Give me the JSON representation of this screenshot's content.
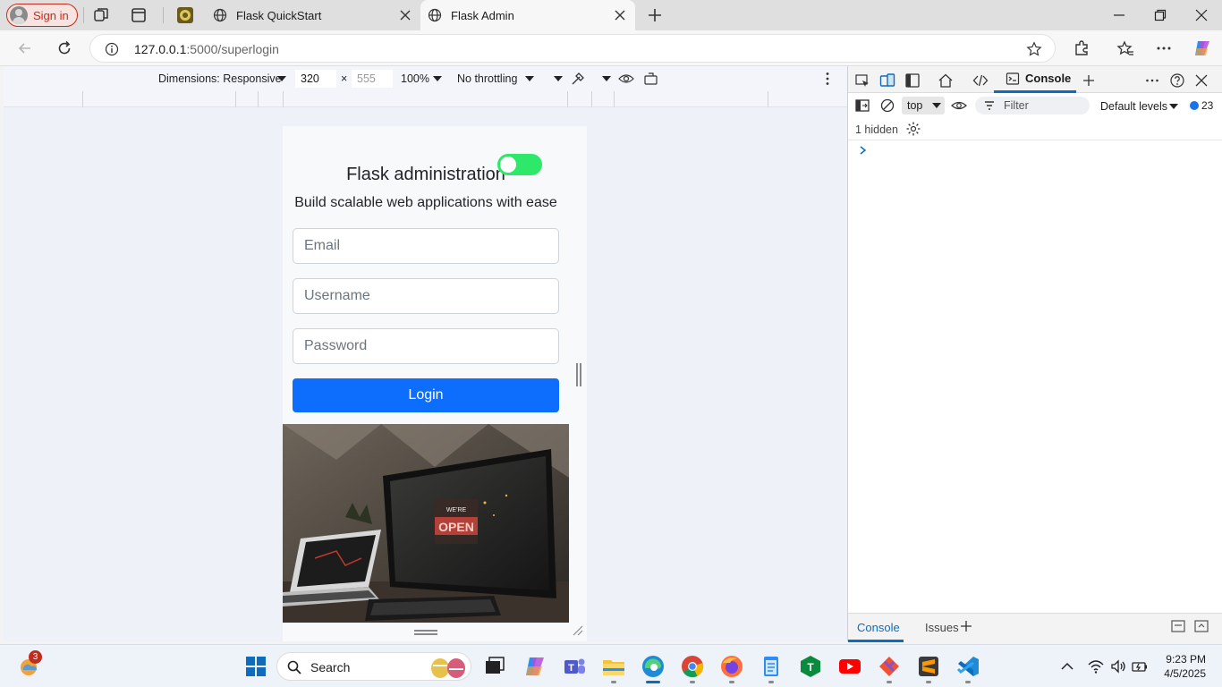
{
  "browser": {
    "sign_in_label": "Sign in",
    "tabs": [
      {
        "title": "Flask QuickStart",
        "active": false
      },
      {
        "title": "Flask Admin",
        "active": true
      }
    ],
    "url_host": "127.0.0.1",
    "url_rest": ":5000/superlogin"
  },
  "device_toolbar": {
    "dimensions_label": "Dimensions: Responsive",
    "width": "320",
    "height": "555",
    "zoom": "100%",
    "throttling": "No throttling"
  },
  "page": {
    "title": "Flask administration",
    "subtitle": "Build scalable web applications with ease",
    "toggle_on": true,
    "email_placeholder": "Email",
    "username_placeholder": "Username",
    "password_placeholder": "Password",
    "login_label": "Login",
    "sign_text": "OPEN",
    "sign_small": "WE'RE"
  },
  "devtools": {
    "active_tab": "Console",
    "context": "top",
    "filter_placeholder": "Filter",
    "levels": "Default levels",
    "message_count": "23",
    "hidden_text": "1 hidden",
    "bottom_tabs": [
      "Console",
      "Issues"
    ]
  },
  "taskbar": {
    "search_label": "Search",
    "mail_badge": "3",
    "time": "9:23 PM",
    "date": "4/5/2025"
  },
  "colors": {
    "primary": "#0d6efd",
    "toggle": "#2ee86a",
    "devtools_accent": "#0f6cbd",
    "signin": "#c42b1c"
  },
  "icons": [
    "profile-icon",
    "workspaces-icon",
    "tab-actions-icon",
    "globe-icon",
    "close-icon",
    "plus-icon",
    "minimize-icon",
    "maximize-icon",
    "back-icon",
    "refresh-icon",
    "info-icon",
    "star-icon",
    "extensions-icon",
    "favorites-icon",
    "more-icon",
    "copilot-icon",
    "inspect-icon",
    "device-icon",
    "dock-icon",
    "home-icon",
    "elements-icon",
    "console-icon",
    "help-icon",
    "sidebar-icon",
    "clear-icon",
    "eye-icon",
    "filter-icon",
    "gear-icon",
    "windows-icon",
    "search-icon",
    "edge-icon",
    "chrome-icon",
    "firefox-icon",
    "vscode-icon"
  ]
}
